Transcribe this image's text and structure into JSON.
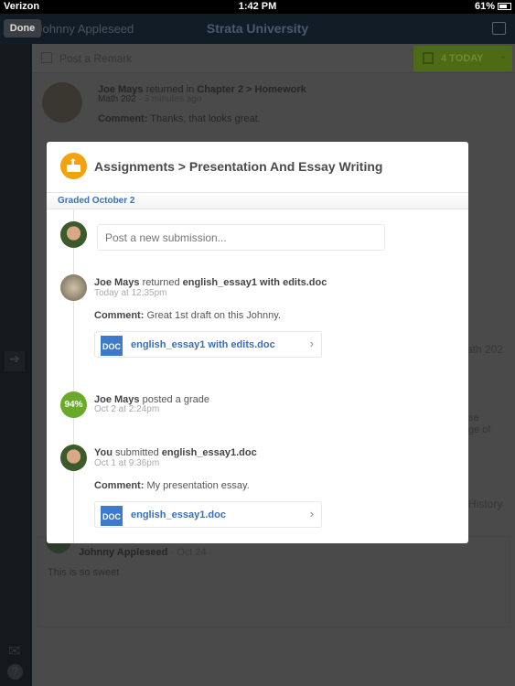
{
  "status_bar": {
    "carrier": "Verizon",
    "time": "1:42 PM",
    "battery": "61%"
  },
  "nav": {
    "done_label": "Done",
    "user_name": "Johnny Appleseed",
    "title": "Strata University"
  },
  "background": {
    "post_remark": "Post a Remark",
    "today_button": "4 TODAY",
    "feed_item": {
      "author": "Joe Mays",
      "action": "returned in",
      "target": "Chapter 2 > Homework",
      "course": "Math 202",
      "time": "3 minutes ago",
      "comment_label": "Comment:",
      "comment": "Thanks, that looks great."
    },
    "fragments": [
      "ath 202",
      "se",
      "ge of",
      "History"
    ],
    "comment_item": {
      "author": "Johnny Appleseed",
      "date": "Oct 24",
      "text": "This is so sweet"
    }
  },
  "modal": {
    "title": "Assignments > Presentation And Essay Writing",
    "graded_label": "Graded October 2",
    "submission_placeholder": "Post a new submission...",
    "items": [
      {
        "author": "Joe Mays",
        "action": "returned",
        "file": "english_essay1 with edits.doc",
        "time": "Today at 12:35pm",
        "comment_label": "Comment:",
        "comment": "Great 1st draft on this Johnny.",
        "doc_badge": "DOC",
        "doc_name": "english_essay1 with edits.doc"
      },
      {
        "grade": "94%",
        "author": "Joe Mays",
        "action": "posted a grade",
        "time": "Oct 2 at 2:24pm"
      },
      {
        "author": "You",
        "action": "submitted",
        "file": "english_essay1.doc",
        "time": "Oct 1 at 9:36pm",
        "comment_label": "Comment:",
        "comment": "My presentation essay.",
        "doc_badge": "DOC",
        "doc_name": "english_essay1.doc"
      }
    ]
  },
  "colors": {
    "accent_blue": "#3a6fb5",
    "grade_green": "#6aaa2a",
    "assignment_orange": "#f2a20c",
    "today_green": "#4d6a16"
  }
}
